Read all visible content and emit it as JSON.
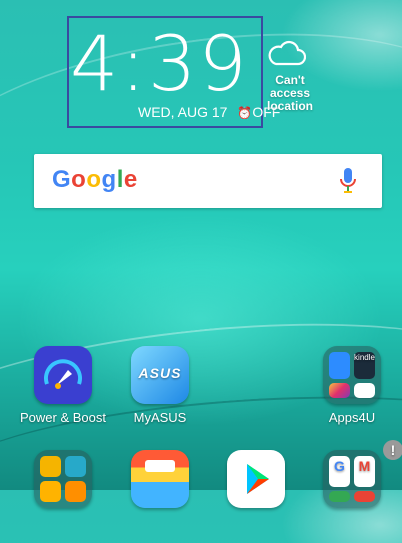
{
  "clock": {
    "time": "4:39",
    "date": "WED, AUG 17",
    "alarm": "OFF",
    "alarm_icon": "alarm-clock-icon"
  },
  "weather": {
    "message": "Can't access location",
    "icon": "cloud-icon"
  },
  "search": {
    "logo": "Google",
    "mic_icon": "microphone-icon"
  },
  "apps_row1": [
    {
      "label": "Power & Boost",
      "icon": "power-boost-icon"
    },
    {
      "label": "MyASUS",
      "icon": "myasus-icon",
      "icon_text": "ASUS"
    },
    {
      "label": "Apps4U",
      "icon": "folder-icon",
      "mini_text": [
        "kindle"
      ]
    }
  ],
  "apps_row2": [
    {
      "icon": "folder-icon"
    },
    {
      "icon": "theme-paint-icon"
    },
    {
      "icon": "play-store-icon"
    },
    {
      "icon": "folder-icon",
      "badge": "!"
    }
  ],
  "colors": {
    "google_blue": "#4285F4",
    "google_red": "#EA4335",
    "google_yellow": "#FBBC05",
    "google_green": "#34A853"
  }
}
